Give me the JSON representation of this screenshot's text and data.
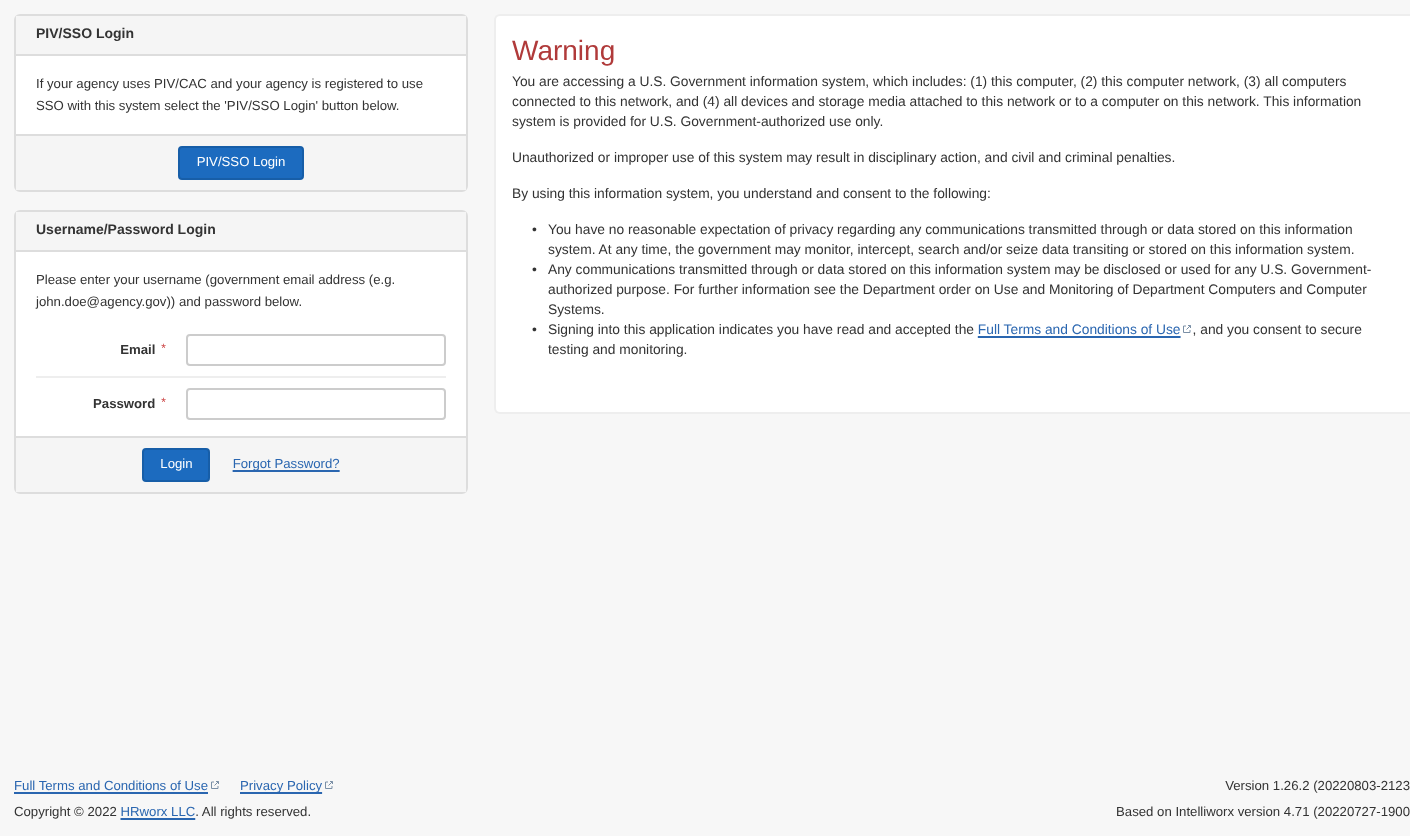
{
  "piv_panel": {
    "title": "PIV/SSO Login",
    "text": "If your agency uses PIV/CAC and your agency is registered to use SSO with this system select the 'PIV/SSO Login' button below.",
    "button": "PIV/SSO Login"
  },
  "login_panel": {
    "title": "Username/Password Login",
    "text": "Please enter your username (government email address (e.g. john.doe@agency.gov)) and password below.",
    "fields": [
      {
        "label": "Email",
        "mark": "*"
      },
      {
        "label": "Password",
        "mark": "*"
      }
    ],
    "button": "Login",
    "link": "Forgot Password?"
  },
  "warning": {
    "title": "Warning",
    "paragraphs": [
      "You are accessing a U.S. Government information system, which includes: (1) this computer, (2) this computer network, (3) all computers connected to this network, and (4) all devices and storage media attached to this network or to a computer on this network. This information system is provided for U.S. Government-authorized use only.",
      "Unauthorized or improper use of this system may result in disciplinary action, and civil and criminal penalties.",
      "By using this information system, you understand and consent to the following:"
    ],
    "bullets": [
      {
        "marker": "•",
        "text": "You have no reasonable expectation of privacy regarding any communications transmitted through or data stored on this information system. At any time, the government may monitor, intercept, search and/or seize data transiting or stored on this information system."
      },
      {
        "marker": "•",
        "text": "Any communications transmitted through or data stored on this information system may be disclosed or used for any U.S. Government-authorized purpose. For further information see the Department order on Use and Monitoring of Department Computers and Computer Systems."
      },
      {
        "marker": "•",
        "text": "Signing into this application indicates you have read and accepted the ",
        "link": "Full Terms and Conditions of Use",
        "after": ", and you consent to secure testing and monitoring."
      }
    ]
  },
  "footer": {
    "links": [
      "Full Terms and Conditions of Use",
      "Privacy Policy"
    ],
    "copyright": {
      "before": "Copyright © 2022 ",
      "link": "HRworx LLC",
      "after": ". All rights reserved."
    },
    "version": "Version 1.26.2 (20220803-2123",
    "based_on": "Based on Intelliworx version 4.71 (20220727-1900"
  }
}
